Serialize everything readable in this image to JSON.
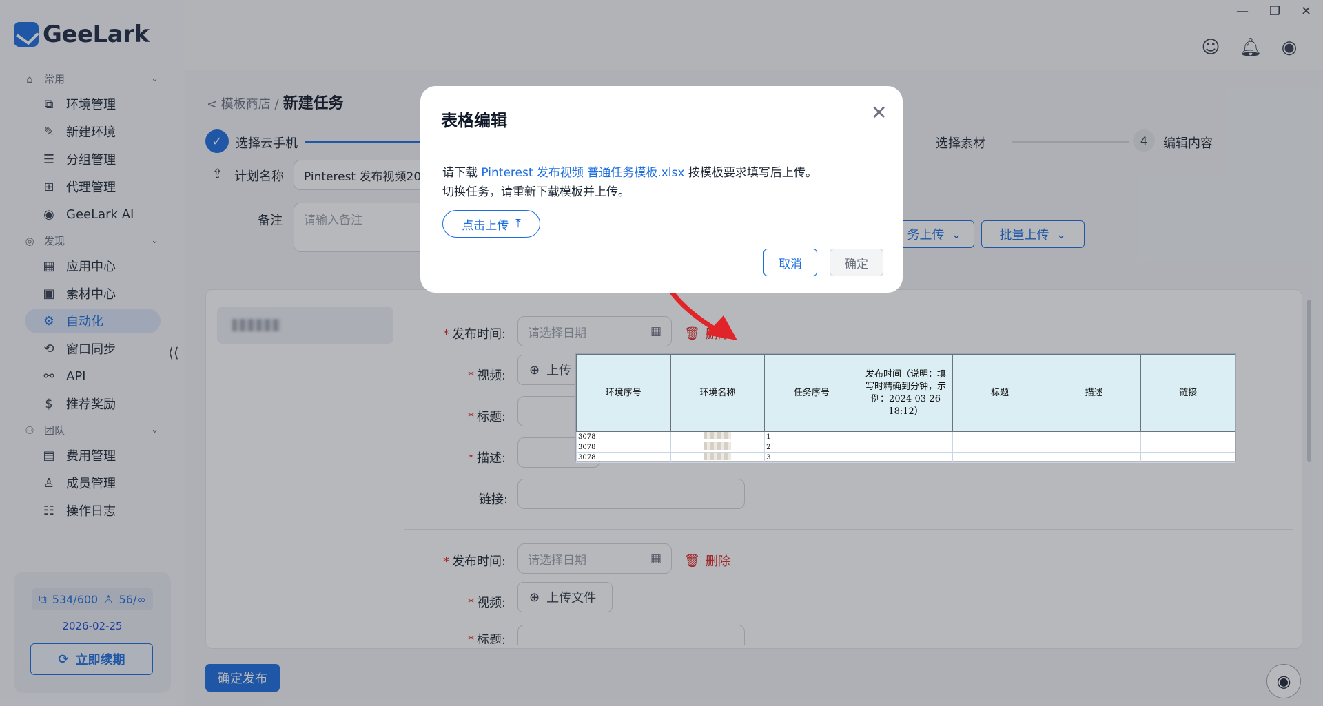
{
  "app": {
    "logo_text": "GeeLark"
  },
  "sidebar": {
    "groups": [
      {
        "label": "常用",
        "icon": "home-icon"
      },
      {
        "label": "发现",
        "icon": "eye-icon"
      },
      {
        "label": "团队",
        "icon": "team-icon"
      }
    ],
    "items": [
      {
        "label": "环境管理",
        "icon": "environment-icon"
      },
      {
        "label": "新建环境",
        "icon": "edit-icon"
      },
      {
        "label": "分组管理",
        "icon": "list-icon"
      },
      {
        "label": "代理管理",
        "icon": "proxy-icon"
      },
      {
        "label": "GeeLark AI",
        "icon": "ai-icon"
      },
      {
        "label": "应用中心",
        "icon": "apps-icon"
      },
      {
        "label": "素材中心",
        "icon": "media-icon"
      },
      {
        "label": "自动化",
        "icon": "robot-icon"
      },
      {
        "label": "窗口同步",
        "icon": "sync-icon"
      },
      {
        "label": "API",
        "icon": "api-icon"
      },
      {
        "label": "推荐奖励",
        "icon": "dollar-icon"
      },
      {
        "label": "费用管理",
        "icon": "billing-icon"
      },
      {
        "label": "成员管理",
        "icon": "member-icon"
      },
      {
        "label": "操作日志",
        "icon": "log-icon"
      }
    ],
    "collapse_glyph": "⟨⟨",
    "quota": {
      "devices": "534/600",
      "members": "56/∞",
      "date": "2026-02-25",
      "renew_label": "立即续期"
    }
  },
  "topbar": {
    "window_controls": [
      "—",
      "❐",
      "✕"
    ]
  },
  "page": {
    "breadcrumb_parent": "< 模板商店 /",
    "title": "新建任务",
    "steps": [
      {
        "label": "选择云手机"
      },
      {
        "label": "选择素材"
      },
      {
        "num": "4",
        "label": "编辑内容"
      }
    ],
    "plan_label": "计划名称",
    "plan_value": "Pinterest 发布视频202",
    "note_label": "备注",
    "note_placeholder": "请输入备注",
    "task_upload_label": "务上传",
    "batch_upload_label": "批量上传",
    "form": {
      "publish_time_label": "发布时间:",
      "date_placeholder": "请选择日期",
      "delete_label": "删除",
      "video_label": "视频:",
      "upload_file_label": "上传文件",
      "upload_short": "上传",
      "title_label": "标题:",
      "desc_label": "描述:",
      "link_label": "链接:",
      "title_partial": "标题:"
    },
    "publish_button": "确定发布"
  },
  "sheet": {
    "headers": [
      "环境序号",
      "环境名称",
      "任务序号",
      "发布时间（说明：填写时精确到分钟，示例：2024-03-26 18:12）",
      "标题",
      "描述",
      "链接"
    ],
    "rows": [
      {
        "env_no": "3078",
        "task_no": "1"
      },
      {
        "env_no": "3078",
        "task_no": "2"
      },
      {
        "env_no": "3078",
        "task_no": "3"
      }
    ]
  },
  "modal": {
    "title": "表格编辑",
    "text_prefix": "请下载 ",
    "template_link": "Pinterest 发布视频 普通任务模板.xlsx",
    "text_suffix": " 按模板要求填写后上传。",
    "text_line2": "切换任务，请重新下载模板并上传。",
    "upload_label": "点击上传",
    "cancel_label": "取消",
    "ok_label": "确定"
  },
  "colors": {
    "accent": "#1d6fe0",
    "danger": "#dc2626",
    "arrow": "#e0242a"
  }
}
